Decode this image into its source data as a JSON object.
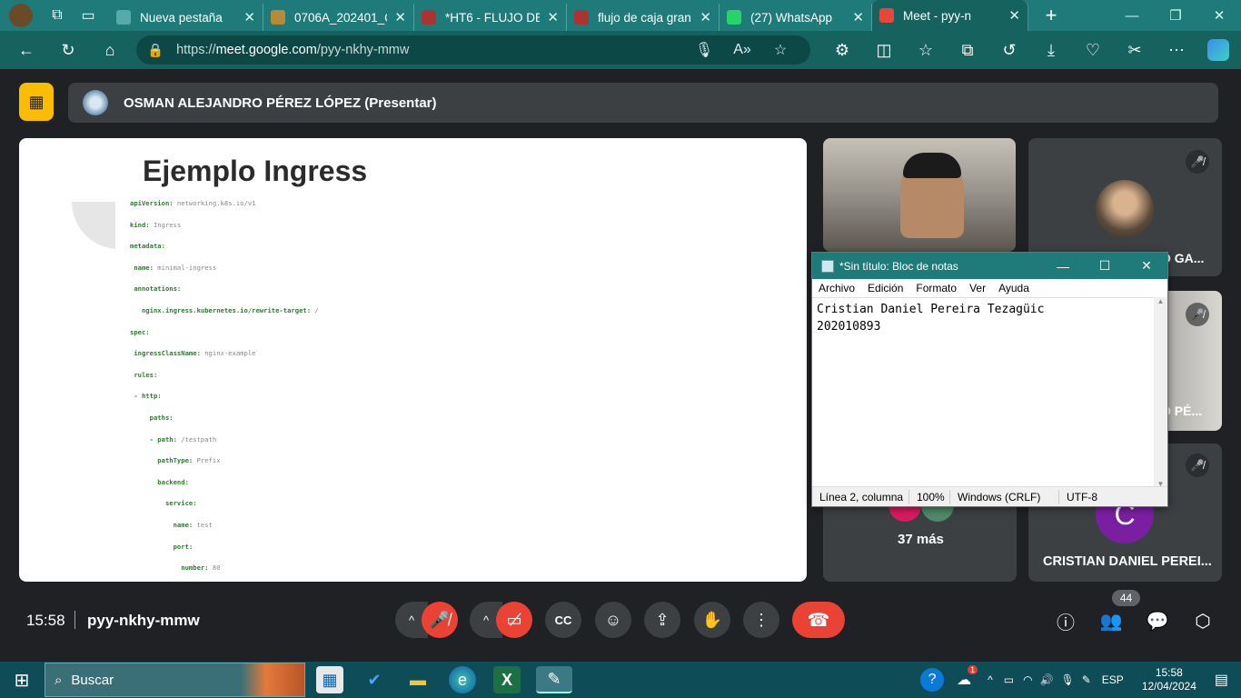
{
  "browser": {
    "tabs": [
      {
        "label": "Nueva pestaña",
        "icon": "new-tab-icon",
        "color": "#5aa"
      },
      {
        "label": "0706A_202401_C",
        "icon": "cloud-icon",
        "color": "#b58b3a"
      },
      {
        "label": "*HT6 - FLUJO DE",
        "icon": "pdf-icon",
        "color": "#a33"
      },
      {
        "label": "flujo de caja gran",
        "icon": "pdf-icon",
        "color": "#a33"
      },
      {
        "label": "(27) WhatsApp",
        "icon": "whatsapp-icon",
        "color": "#25d366"
      },
      {
        "label": "Meet - pyy-n",
        "icon": "meet-icon",
        "color": "#e8453c"
      }
    ],
    "url_prefix": "https://",
    "url_host": "meet.google.com",
    "url_path": "/pyy-nkhy-mmw"
  },
  "meet": {
    "presenter": "OSMAN ALEJANDRO PÉREZ LÓPEZ (Presentar)",
    "slide": {
      "title": "Ejemplo Ingress",
      "code_lines": [
        {
          "k": "apiVersion:",
          "v": " networking.k8s.io/v1",
          "indent": 0
        },
        {
          "k": "kind:",
          "v": " Ingress",
          "indent": 0
        },
        {
          "k": "metadata:",
          "v": "",
          "indent": 0
        },
        {
          "k": " name:",
          "v": " minimal-ingress",
          "indent": 0
        },
        {
          "k": " annotations:",
          "v": "",
          "indent": 0
        },
        {
          "k": "   nginx.ingress.kubernetes.io/rewrite-target:",
          "v": " /",
          "indent": 0
        },
        {
          "k": "spec:",
          "v": "",
          "indent": 0
        },
        {
          "k": " ingressClassName:",
          "v": " nginx-example",
          "indent": 0
        },
        {
          "k": " rules:",
          "v": "",
          "indent": 0
        },
        {
          "k": " - http:",
          "v": "",
          "indent": 0
        },
        {
          "k": "     paths:",
          "v": "",
          "indent": 0
        },
        {
          "k": "     - path:",
          "v": " /testpath",
          "indent": 0
        },
        {
          "k": "       pathType:",
          "v": " Prefix",
          "indent": 0
        },
        {
          "k": "       backend:",
          "v": "",
          "indent": 0
        },
        {
          "k": "         service:",
          "v": "",
          "indent": 0
        },
        {
          "k": "           name:",
          "v": " test",
          "indent": 0
        },
        {
          "k": "           port:",
          "v": "",
          "indent": 0
        },
        {
          "k": "             number:",
          "v": " 80",
          "indent": 0
        }
      ]
    },
    "tiles": {
      "participant_a_name": "O GA...",
      "participant_b_name": "O PÉ...",
      "more_label": "37 más",
      "cristian_name": "CRISTIAN DANIEL PEREI...",
      "cristian_initial": "C"
    },
    "clock": "15:58",
    "meeting_code": "pyy-nkhy-mmw",
    "participant_count": "44"
  },
  "notepad": {
    "title": "*Sin título: Bloc de notas",
    "menu": [
      "Archivo",
      "Edición",
      "Formato",
      "Ver",
      "Ayuda"
    ],
    "content": "Cristian Daniel Pereira Tezagüic\n202010893",
    "status": {
      "position": "Línea 2, columna",
      "zoom": "100%",
      "eol": "Windows (CRLF)",
      "encoding": "UTF-8"
    }
  },
  "taskbar": {
    "search_placeholder": "Buscar",
    "language": "ESP",
    "time": "15:58",
    "date": "12/04/2024",
    "notification_count": "1"
  }
}
